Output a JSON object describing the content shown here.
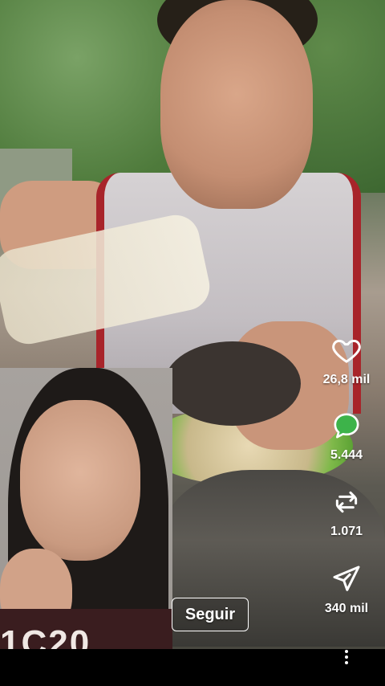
{
  "actions": {
    "like": {
      "icon": "heart-icon",
      "count": "26,8 mil"
    },
    "comment": {
      "icon": "comment-bubble-icon",
      "count": "5.444"
    },
    "repost": {
      "icon": "repost-icon",
      "count": "1.071"
    },
    "share": {
      "icon": "send-icon",
      "count": "340 mil"
    },
    "more": {
      "icon": "more-vertical-icon"
    }
  },
  "follow_button": {
    "label": "Seguir"
  },
  "pip": {
    "shirt_text": "1C20"
  },
  "colors": {
    "comment_badge": "#3db34a",
    "jersey_trim": "#a8242a",
    "plate_green": "#4f9a2c"
  }
}
